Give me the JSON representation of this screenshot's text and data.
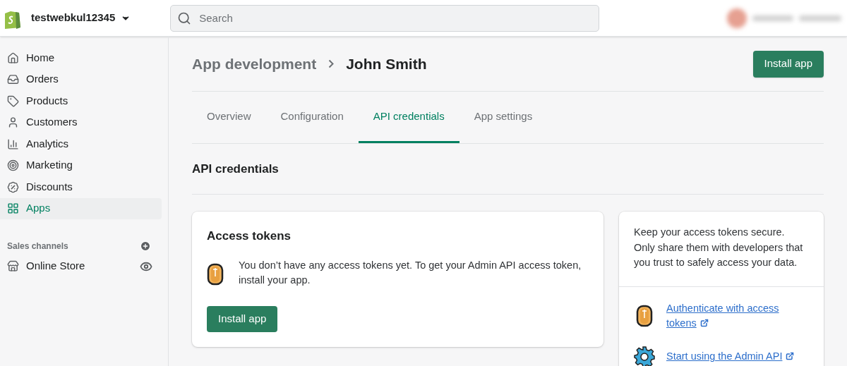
{
  "topbar": {
    "store_name": "testwebkul12345",
    "search": {
      "placeholder": "Search"
    }
  },
  "sidebar": {
    "items": [
      {
        "label": "Home",
        "selected": false
      },
      {
        "label": "Orders",
        "selected": false
      },
      {
        "label": "Products",
        "selected": false
      },
      {
        "label": "Customers",
        "selected": false
      },
      {
        "label": "Analytics",
        "selected": false
      },
      {
        "label": "Marketing",
        "selected": false
      },
      {
        "label": "Discounts",
        "selected": false
      },
      {
        "label": "Apps",
        "selected": true
      }
    ],
    "section_title": "Sales channels",
    "channels": [
      {
        "label": "Online Store"
      }
    ]
  },
  "page": {
    "breadcrumb": "App development",
    "title": "John Smith",
    "primary_button": "Install app"
  },
  "tabs": [
    {
      "label": "Overview",
      "selected": false
    },
    {
      "label": "Configuration",
      "selected": false
    },
    {
      "label": "API credentials",
      "selected": true
    },
    {
      "label": "App settings",
      "selected": false
    }
  ],
  "section_heading": "API credentials",
  "access_tokens_card": {
    "title": "Access tokens",
    "message": "You don’t have any access tokens yet. To get your Admin API access token, install your app.",
    "button": "Install app"
  },
  "info_card": {
    "text": "Keep your access tokens secure. Only share them with developers that you trust to safely access your data.",
    "links": [
      {
        "kind": "coin",
        "label": "Authenticate with access tokens"
      },
      {
        "kind": "gear",
        "label": "Start using the Admin API"
      }
    ]
  }
}
